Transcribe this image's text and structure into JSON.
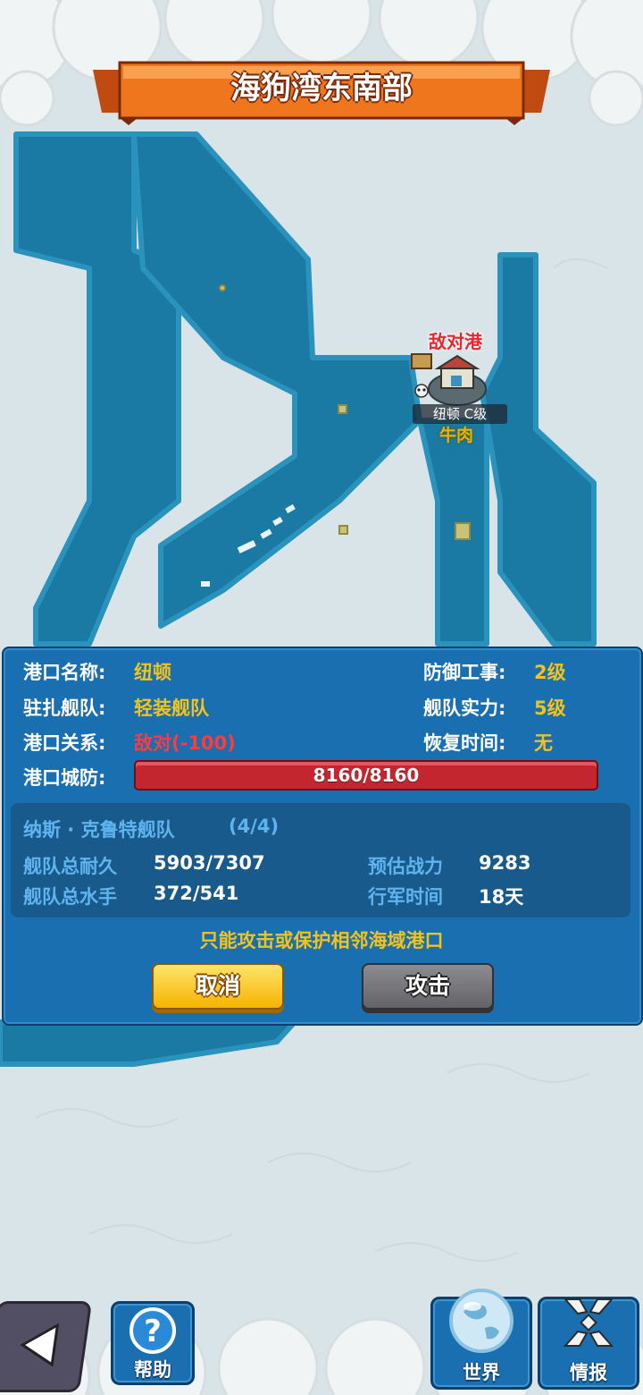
{
  "header": {
    "title": "海狗湾东南部"
  },
  "map": {
    "port_relation_label": "敌对港",
    "port_name_tag": "纽顿 C级",
    "port_resource": "牛肉"
  },
  "port_info": {
    "name_label": "港口名称:",
    "name_value": "纽顿",
    "defense_label": "防御工事:",
    "defense_value": "2级",
    "garrison_label": "驻扎舰队:",
    "garrison_value": "轻装舰队",
    "fleet_power_label": "舰队实力:",
    "fleet_power_value": "5级",
    "relation_label": "港口关系:",
    "relation_value": "敌对(-100)",
    "recovery_label": "恢复时间:",
    "recovery_value": "无",
    "city_defense_label": "港口城防:",
    "city_defense_value": "8160/8160",
    "city_defense_fraction": 1.0
  },
  "fleet": {
    "name": "纳斯 · 克鲁特舰队",
    "count": "(4/4)",
    "durability_label": "舰队总耐久",
    "durability_value": "5903/7307",
    "sailors_label": "舰队总水手",
    "sailors_value": "372/541",
    "power_label": "预估战力",
    "power_value": "9283",
    "march_label": "行军时间",
    "march_value": "18天"
  },
  "notice": "只能攻击或保护相邻海域港口",
  "buttons": {
    "cancel": "取消",
    "attack": "攻击"
  },
  "nav": {
    "help": "帮助",
    "world": "世界",
    "intel": "情报"
  },
  "colors": {
    "sea": "#1a7aa3",
    "ice": "#d9e4e8",
    "panel": "#1a6fb0",
    "accent_yellow": "#f2c31c",
    "enemy_red": "#e8262e"
  }
}
